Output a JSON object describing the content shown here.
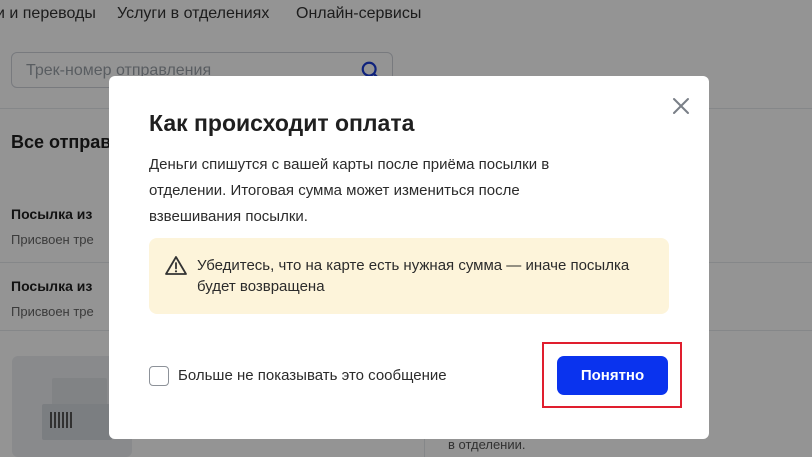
{
  "nav": {
    "items": [
      "и и переводы",
      "Услуги в отделениях",
      "Онлайн-сервисы"
    ]
  },
  "search": {
    "placeholder": "Трек-номер отправления"
  },
  "sections": {
    "all_title": "Все отправ"
  },
  "parcels": [
    {
      "title": "Посылка из",
      "subtitle": "Присвоен тре"
    },
    {
      "title": "Посылка из",
      "subtitle": "Присвоен тре"
    }
  ],
  "background_bottom": {
    "text": "в отделении."
  },
  "modal": {
    "title": "Как происходит оплата",
    "description": "Деньги спишутся с вашей карты после приёма посылки в отделении. Итоговая сумма может измениться после взвешивания посылки.",
    "warning": "Убедитесь, что на карте есть нужная сумма — иначе посылка будет возвращена",
    "checkbox_label": "Больше не показывать это сообщение",
    "checkbox_checked": false,
    "confirm_label": "Понятно"
  },
  "colors": {
    "primary_button": "#0a33ee",
    "warning_bg": "#fdf4da",
    "highlight_border": "#e01e2e",
    "overlay": "rgba(0,0,0,0.42)"
  },
  "icons": {
    "search": "search-icon",
    "close": "close-icon",
    "warning": "warning-triangle-icon"
  }
}
